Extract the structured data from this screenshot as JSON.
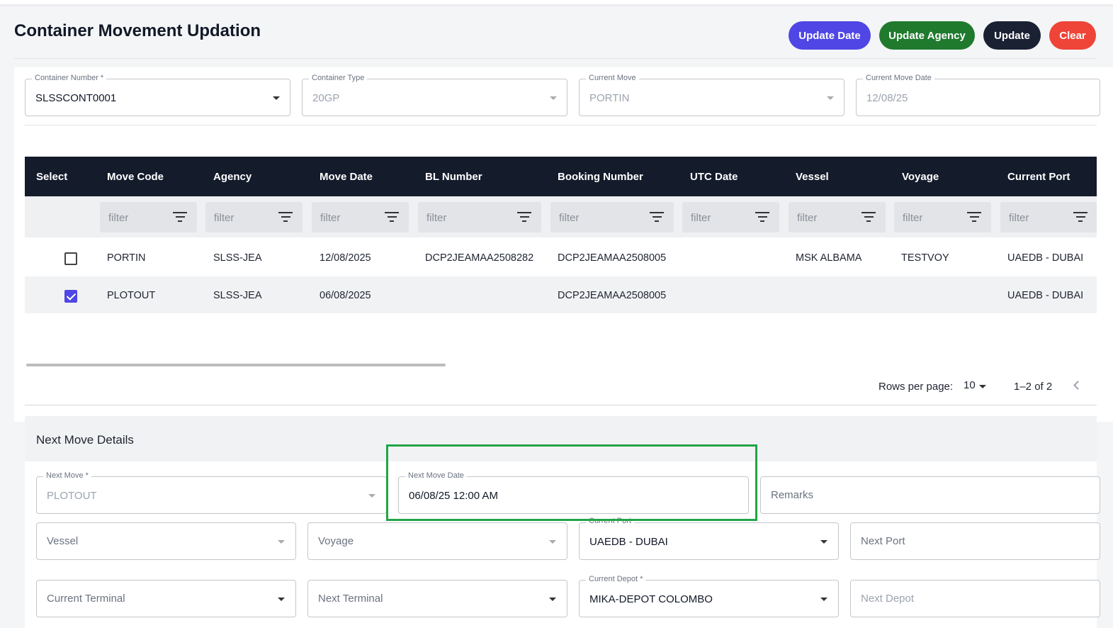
{
  "page": {
    "title": "Container Movement Updation"
  },
  "toolbar": {
    "update_date": "Update Date",
    "update_agency": "Update Agency",
    "update": "Update",
    "clear": "Clear"
  },
  "colors": {
    "update_date": "#4f46e5",
    "update_agency": "#1f7a2e",
    "update": "#1a2133",
    "clear": "#ef4438",
    "grid_header": "#141b2b",
    "highlight_border": "#22a547"
  },
  "container_fields": {
    "container_number": {
      "label": "Container Number *",
      "value": "SLSSCONT0001"
    },
    "container_type": {
      "label": "Container Type",
      "value": "20GP"
    },
    "current_move": {
      "label": "Current Move",
      "value": "PORTIN"
    },
    "current_move_date": {
      "label": "Current Move Date",
      "value": "12/08/25"
    }
  },
  "grid": {
    "columns": [
      "Select",
      "Move Code",
      "Agency",
      "Move Date",
      "BL Number",
      "Booking Number",
      "UTC Date",
      "Vessel",
      "Voyage",
      "Current Port"
    ],
    "filter_placeholder": "filter",
    "rows": [
      {
        "selected": false,
        "move_code": "PORTIN",
        "agency": "SLSS-JEA",
        "move_date": "12/08/2025",
        "bl_number": "DCP2JEAMAA2508282",
        "booking_number": "DCP2JEAMAA2508005",
        "utc_date": "",
        "vessel": "MSK ALBAMA",
        "voyage": "TESTVOY",
        "current_port": "UAEDB - DUBAI"
      },
      {
        "selected": true,
        "move_code": "PLOTOUT",
        "agency": "SLSS-JEA",
        "move_date": "06/08/2025",
        "bl_number": "",
        "booking_number": "DCP2JEAMAA2508005",
        "utc_date": "",
        "vessel": "",
        "voyage": "",
        "current_port": "UAEDB - DUBAI"
      }
    ],
    "pagination": {
      "rows_per_page_label": "Rows per page:",
      "rows_per_page": "10",
      "range": "1–2 of 2"
    }
  },
  "next_move": {
    "heading": "Next Move Details",
    "next_move": {
      "label": "Next Move *",
      "value": "PLOTOUT"
    },
    "next_move_date": {
      "label": "Next Move Date",
      "value": "06/08/25 12:00 AM"
    },
    "remarks": {
      "placeholder": "Remarks"
    },
    "vessel": {
      "placeholder": "Vessel"
    },
    "voyage": {
      "placeholder": "Voyage"
    },
    "current_port": {
      "label": "Current Port",
      "value": "UAEDB - DUBAI"
    },
    "next_port": {
      "placeholder": "Next Port"
    },
    "current_terminal": {
      "placeholder": "Current Terminal"
    },
    "next_terminal": {
      "placeholder": "Next Terminal"
    },
    "current_depot": {
      "label": "Current Depot *",
      "value": "MIKA-DEPOT COLOMBO"
    },
    "next_depot": {
      "placeholder": "Next Depot"
    }
  }
}
